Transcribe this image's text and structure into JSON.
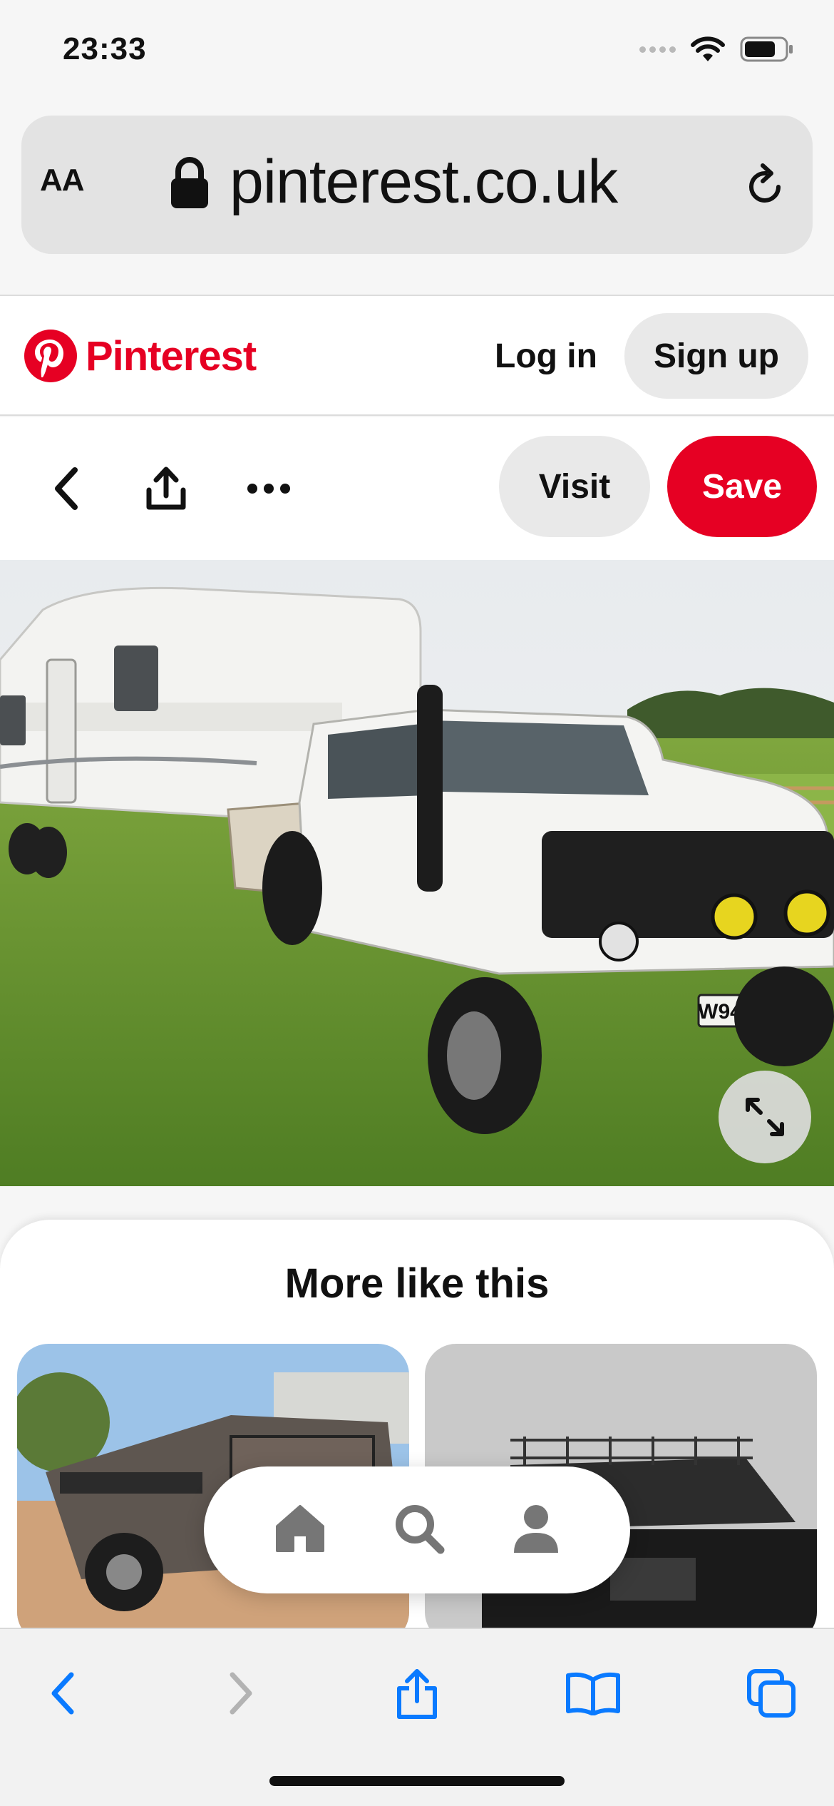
{
  "status_bar": {
    "time": "23:33"
  },
  "browser": {
    "text_size_label": "AA",
    "url": "pinterest.co.uk"
  },
  "header": {
    "brand": "Pinterest",
    "login_label": "Log in",
    "signup_label": "Sign up"
  },
  "pin_actions": {
    "visit_label": "Visit",
    "save_label": "Save"
  },
  "pin": {
    "plate_text": "W94 VEC"
  },
  "more": {
    "title": "More like this"
  },
  "colors": {
    "brand_red": "#e60023",
    "ios_blue": "#0a7aff"
  },
  "icons": {
    "back": "chevron-left-icon",
    "share": "share-icon",
    "more": "ellipsis-icon",
    "expand": "expand-icon",
    "home": "home-icon",
    "search": "search-icon",
    "profile": "profile-icon",
    "bookmarks": "book-icon",
    "tabs": "tabs-icon"
  }
}
